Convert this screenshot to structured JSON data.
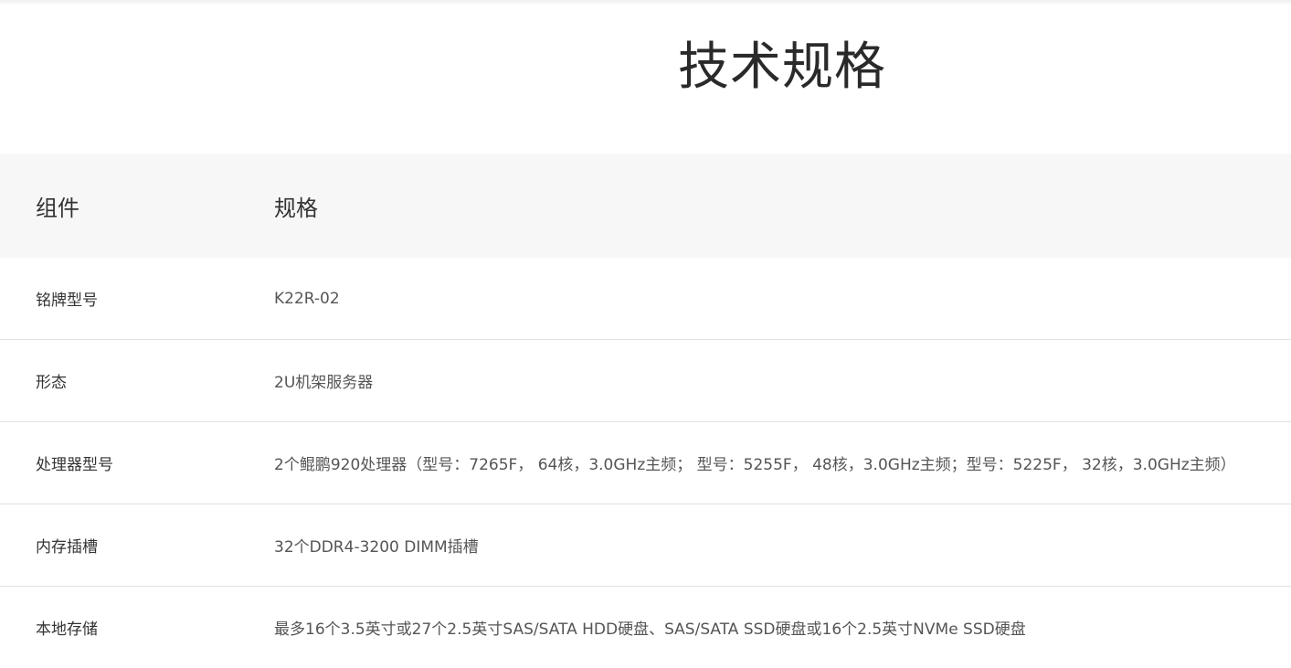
{
  "title": "技术规格",
  "table": {
    "header": {
      "component": "组件",
      "spec": "规格"
    },
    "rows": [
      {
        "component": "铭牌型号",
        "spec": "K22R-02"
      },
      {
        "component": "形态",
        "spec": "2U机架服务器"
      },
      {
        "component": "处理器型号",
        "spec": "2个鲲鹏920处理器（型号：7265F， 64核，3.0GHz主频； 型号：5255F， 48核，3.0GHz主频；型号：5225F， 32核，3.0GHz主频）"
      },
      {
        "component": "内存插槽",
        "spec": "32个DDR4-3200 DIMM插槽"
      },
      {
        "component": "本地存储",
        "spec": "最多16个3.5英寸或27个2.5英寸SAS/SATA HDD硬盘、SAS/SATA SSD硬盘或16个2.5英寸NVMe SSD硬盘"
      }
    ]
  }
}
